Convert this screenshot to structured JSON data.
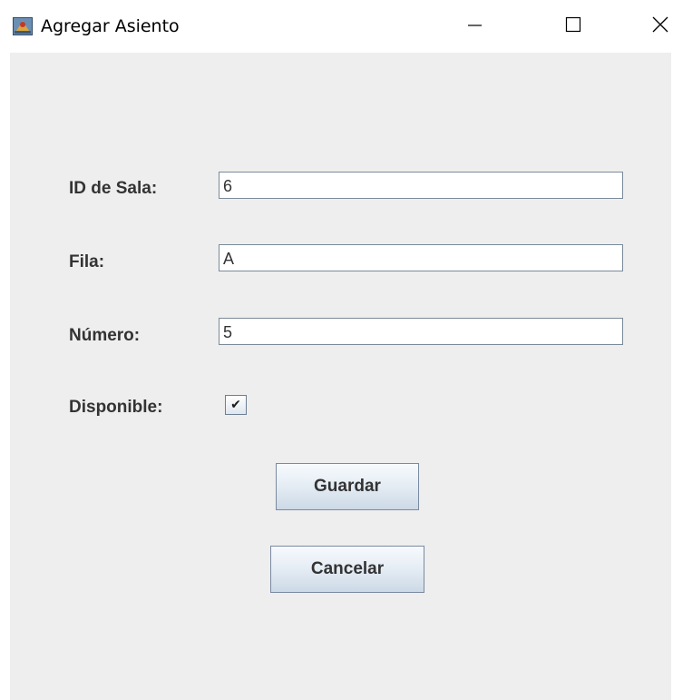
{
  "window": {
    "title": "Agregar Asiento",
    "controls": {
      "minimize_icon": "minimize-icon",
      "maximize_icon": "maximize-icon",
      "close_icon": "close-icon"
    }
  },
  "form": {
    "sala": {
      "label": "ID de Sala:",
      "value": "6"
    },
    "fila": {
      "label": "Fila:",
      "value": "A"
    },
    "numero": {
      "label": "Número:",
      "value": "5"
    },
    "disponible": {
      "label": "Disponible:",
      "checked": true,
      "check_glyph": "✔"
    }
  },
  "buttons": {
    "save_label": "Guardar",
    "cancel_label": "Cancelar"
  },
  "colors": {
    "panel_background": "#eeeeee",
    "label_text": "#333333",
    "button_gradient_top": "#f7fafd",
    "button_gradient_bottom": "#ccd9e6"
  }
}
